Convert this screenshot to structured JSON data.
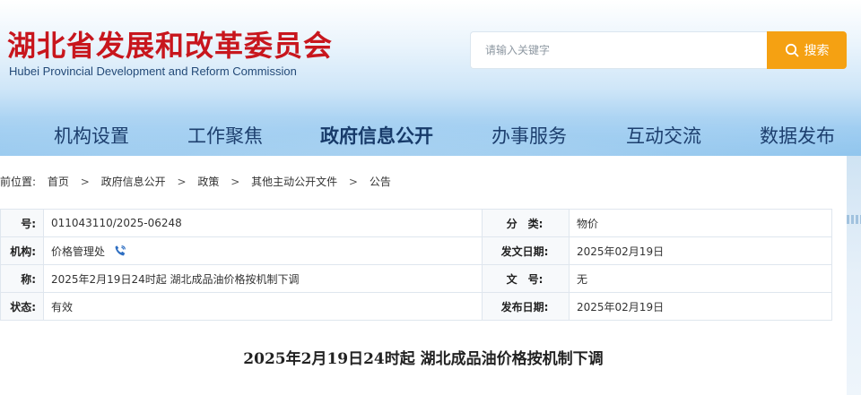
{
  "header": {
    "logo_cn": "湖北省发展和改革委员会",
    "logo_en": "Hubei Provincial Development and Reform Commission",
    "search_placeholder": "请输入关键字",
    "search_button": "搜索"
  },
  "nav": [
    {
      "label": "机构设置"
    },
    {
      "label": "工作聚焦"
    },
    {
      "label": "政府信息公开",
      "active": true
    },
    {
      "label": "办事服务"
    },
    {
      "label": "互动交流"
    },
    {
      "label": "数据发布"
    }
  ],
  "breadcrumb": {
    "prefix": "前位置:",
    "items": [
      "首页",
      "政府信息公开",
      "政策",
      "其他主动公开文件",
      "公告"
    ]
  },
  "info": {
    "row1": {
      "label1": "号:",
      "value1": "011043110/2025-06248",
      "label2": "分　类:",
      "value2": "物价"
    },
    "row2": {
      "label1": "机构:",
      "value1": "价格管理处",
      "label2": "发文日期:",
      "value2": "2025年02月19日"
    },
    "row3": {
      "label1": "称:",
      "value1": "2025年2月19日24时起 湖北成品油价格按机制下调",
      "label2": "文　号:",
      "value2": "无"
    },
    "row4": {
      "label1": "状态:",
      "value1": "有效",
      "label2": "发布日期:",
      "value2": "2025年02月19日"
    }
  },
  "article": {
    "title": "2025年2月19日24时起 湖北成品油价格按机制下调"
  },
  "colors": {
    "logo_red": "#c8161d",
    "nav_blue": "#1d3f6e",
    "search_orange": "#f5a112"
  }
}
